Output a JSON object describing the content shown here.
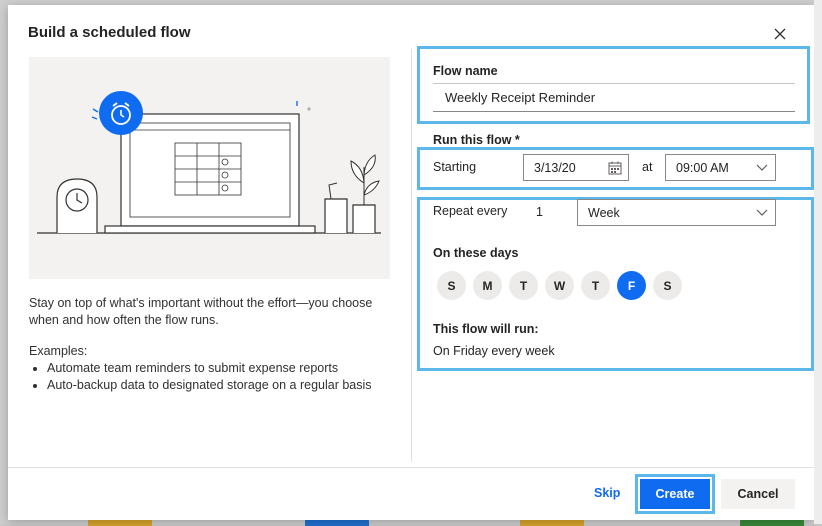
{
  "dialog": {
    "title": "Build a scheduled flow",
    "close_icon": "close-icon"
  },
  "left": {
    "illustration_icon": "alarm-clock-icon",
    "description": "Stay on top of what's important without the effort—you choose when and how often the flow runs.",
    "examples_label": "Examples:",
    "examples": [
      "Automate team reminders to submit expense reports",
      "Auto-backup data to designated storage on a regular basis"
    ]
  },
  "form": {
    "flow_name_label": "Flow name",
    "flow_name_value": "Weekly Receipt Reminder",
    "run_label": "Run this flow *",
    "starting_label": "Starting",
    "start_date": "3/13/20",
    "at_label": "at",
    "start_time": "09:00 AM",
    "repeat_label": "Repeat every",
    "repeat_interval": "1",
    "repeat_unit": "Week",
    "days_label": "On these days",
    "days": [
      {
        "label": "S",
        "selected": false
      },
      {
        "label": "M",
        "selected": false
      },
      {
        "label": "T",
        "selected": false
      },
      {
        "label": "W",
        "selected": false
      },
      {
        "label": "T",
        "selected": false
      },
      {
        "label": "F",
        "selected": true
      },
      {
        "label": "S",
        "selected": false
      }
    ],
    "summary_label": "This flow will run:",
    "summary_text": "On Friday every week"
  },
  "footer": {
    "skip_label": "Skip",
    "create_label": "Create",
    "cancel_label": "Cancel"
  },
  "colors": {
    "accent": "#0f6cf0",
    "highlight": "#5cb7ea"
  }
}
